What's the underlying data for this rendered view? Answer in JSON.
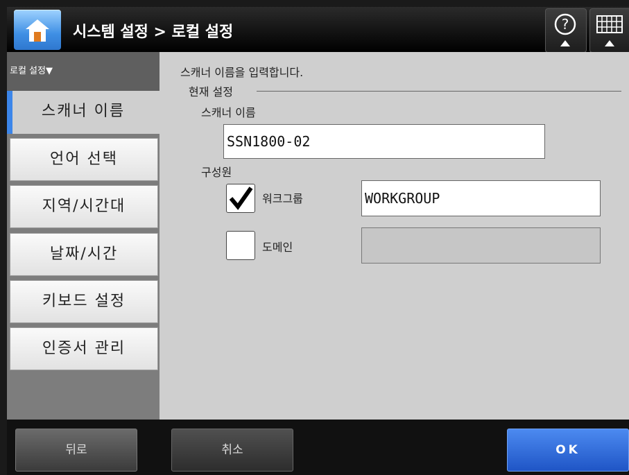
{
  "header": {
    "title": "시스템 설정 > 로컬 설정",
    "home_icon": "home-icon",
    "help_icon": "help-icon",
    "keyboard_icon": "keyboard-icon"
  },
  "sidebar": {
    "heading": "로컬 설정▼",
    "items": [
      {
        "label": "스캐너 이름",
        "active": true
      },
      {
        "label": "언어 선택"
      },
      {
        "label": "지역/시간대"
      },
      {
        "label": "날짜/시간"
      },
      {
        "label": "키보드 설정"
      },
      {
        "label": "인증서 관리"
      }
    ]
  },
  "main": {
    "description": "스캐너 이름을 입력합니다.",
    "section_label": "현재 설정",
    "scanner_name_label": "스캐너 이름",
    "scanner_name_value": "SSN1800-02",
    "member_label": "구성원",
    "workgroup": {
      "label": "워크그룹",
      "checked": true,
      "value": "WORKGROUP"
    },
    "domain": {
      "label": "도메인",
      "checked": false,
      "value": ""
    }
  },
  "footer": {
    "back_label": "뒤로",
    "cancel_label": "취소",
    "ok_label": "OK"
  },
  "colors": {
    "accent": "#3c86ea",
    "ok_button": "#2f6de0"
  }
}
